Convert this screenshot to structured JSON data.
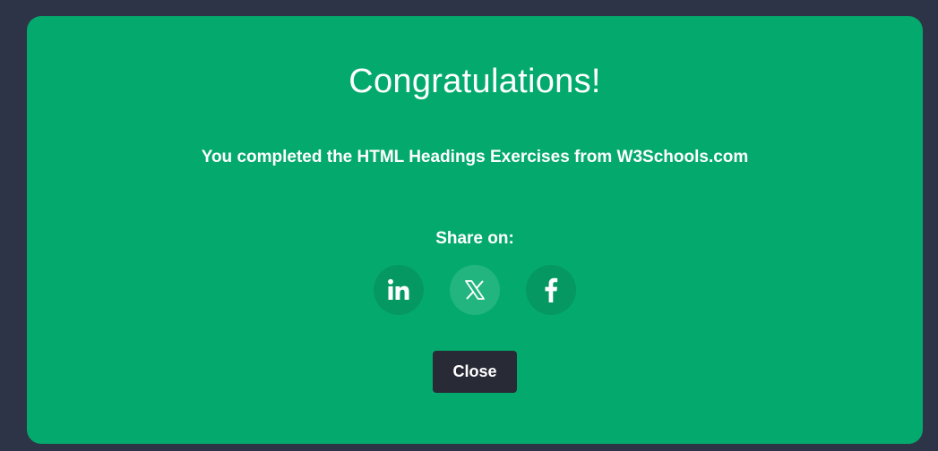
{
  "modal": {
    "title": "Congratulations!",
    "message": "You completed the HTML Headings Exercises from W3Schools.com",
    "share_label": "Share on:",
    "share_buttons": [
      {
        "icon": "linkedin-icon"
      },
      {
        "icon": "x-twitter-icon"
      },
      {
        "icon": "facebook-icon"
      }
    ],
    "close_label": "Close"
  },
  "colors": {
    "backdrop": "#2d3447",
    "modal_bg": "#04aa6d",
    "share_dark": "#059862",
    "share_light": "#22b57f",
    "close_bg": "#282a35",
    "text": "#ffffff"
  }
}
